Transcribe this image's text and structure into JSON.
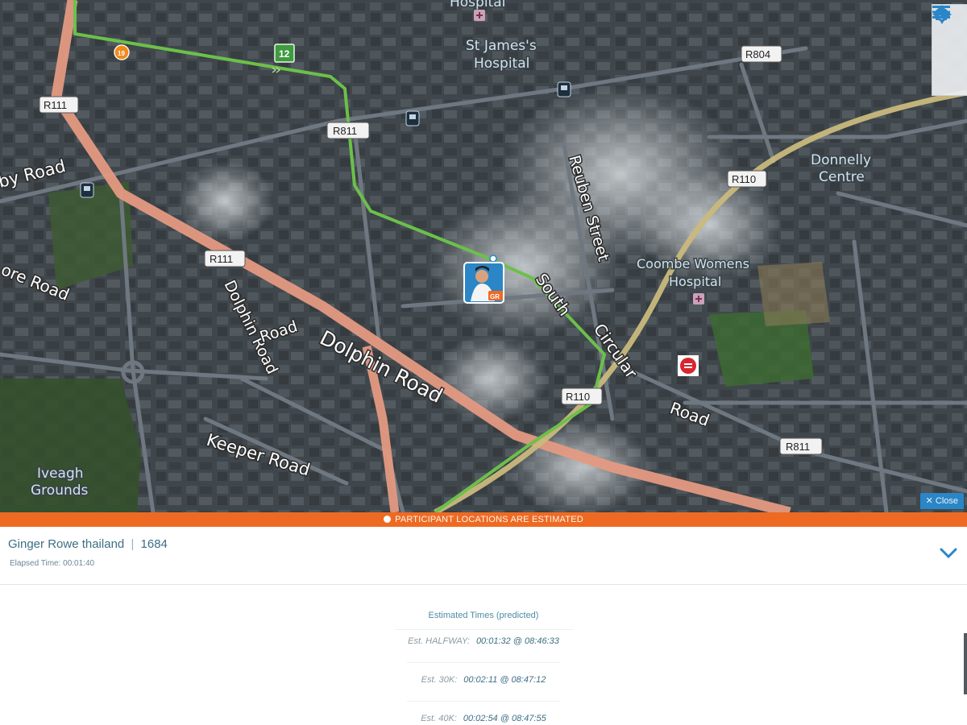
{
  "map": {
    "street_labels": {
      "dolphin_road_main": "Dolphin Road",
      "dolphin_road_side": "Dolphin Road",
      "keeper_road": "Keeper Road",
      "reuben_street": "Reuben Street",
      "south_label": "South",
      "circular_label": "Circular",
      "road_label": "Road",
      "by_road": "by Road",
      "ore_road": "ore Road"
    },
    "place_labels": {
      "hospital_top": "Hospital",
      "st_james_line1": "St James's",
      "st_james_line2": "Hospital",
      "donnelly_line1": "Donnelly",
      "donnelly_line2": "Centre",
      "coombe_line1": "Coombe Womens",
      "coombe_line2": "Hospital",
      "iveagh_line1": "Iveagh",
      "iveagh_line2": "Grounds"
    },
    "road_shields": {
      "r111_a": "R111",
      "r111_b": "R111",
      "r811_a": "R811",
      "r811_b": "R811",
      "r804": "R804",
      "r110_a": "R110",
      "r110_b": "R110"
    },
    "markers": {
      "km_marker": "12",
      "orange_marker": "19",
      "runner_badge": "GR"
    },
    "controls": {
      "menu_icon": "menu-icon",
      "home_icon": "home-icon",
      "locate_icon": "crosshair-icon",
      "close_label": "Close"
    },
    "colors": {
      "course_route": "#6cc04a",
      "main_road": "#e49a82",
      "r110_arc": "#c9b97c",
      "banner": "#ee6a23",
      "accent": "#2a86c7"
    }
  },
  "banner": {
    "text": "PARTICIPANT LOCATIONS ARE ESTIMATED"
  },
  "participant": {
    "name": "Ginger Rowe thailand",
    "separator": "|",
    "bib": "1684",
    "elapsed_label": "Elapsed Time:",
    "elapsed_value": "00:01:40"
  },
  "estimates": {
    "title": "Estimated Times (predicted)",
    "rows": [
      {
        "label": "Est. HALFWAY:",
        "value": "00:01:32 @ 08:46:33"
      },
      {
        "label": "Est. 30K:",
        "value": "00:02:11 @ 08:47:12"
      },
      {
        "label": "Est. 40K:",
        "value": "00:02:54 @ 08:47:55"
      }
    ]
  }
}
